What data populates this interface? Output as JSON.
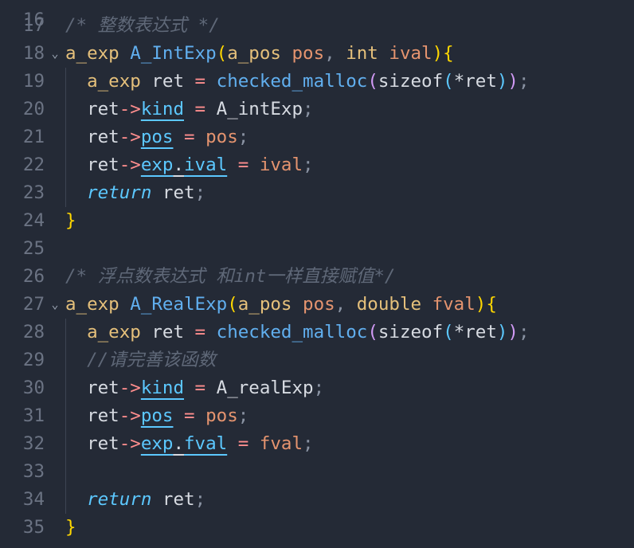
{
  "editor": {
    "top_partial_line_number": "16",
    "lines": [
      {
        "n": "17",
        "fold": false,
        "tokens": [
          {
            "t": "/* 整数表达式 */",
            "c": "t-comment"
          }
        ]
      },
      {
        "n": "18",
        "fold": true,
        "tokens": [
          {
            "t": "a_exp",
            "c": "t-type"
          },
          {
            "t": " ",
            "c": ""
          },
          {
            "t": "A_IntExp",
            "c": "t-fn"
          },
          {
            "t": "(",
            "c": "t-brace"
          },
          {
            "t": "a_pos",
            "c": "t-type"
          },
          {
            "t": " ",
            "c": ""
          },
          {
            "t": "pos",
            "c": "t-param"
          },
          {
            "t": ", ",
            "c": "t-punc"
          },
          {
            "t": "int",
            "c": "t-type"
          },
          {
            "t": " ",
            "c": ""
          },
          {
            "t": "ival",
            "c": "t-param"
          },
          {
            "t": "){",
            "c": "t-brace"
          }
        ]
      },
      {
        "n": "19",
        "fold": false,
        "tokens": [
          {
            "t": "  ",
            "c": ""
          },
          {
            "t": "a_exp",
            "c": "t-type"
          },
          {
            "t": " ",
            "c": ""
          },
          {
            "t": "ret",
            "c": "t-var"
          },
          {
            "t": " = ",
            "c": "t-op"
          },
          {
            "t": "checked_malloc",
            "c": "t-fn"
          },
          {
            "t": "(",
            "c": "t-paren1"
          },
          {
            "t": "sizeof",
            "c": "t-def"
          },
          {
            "t": "(",
            "c": "t-paren2"
          },
          {
            "t": "*",
            "c": "t-var"
          },
          {
            "t": "ret",
            "c": "t-var"
          },
          {
            "t": ")",
            "c": "t-paren2"
          },
          {
            "t": ")",
            "c": "t-paren1"
          },
          {
            "t": ";",
            "c": "t-punc"
          }
        ]
      },
      {
        "n": "20",
        "fold": false,
        "tokens": [
          {
            "t": "  ",
            "c": ""
          },
          {
            "t": "ret",
            "c": "t-var"
          },
          {
            "t": "->",
            "c": "t-op"
          },
          {
            "t": "kind",
            "c": "t-mem u"
          },
          {
            "t": " = ",
            "c": "t-op"
          },
          {
            "t": "A_intExp",
            "c": "t-var"
          },
          {
            "t": ";",
            "c": "t-punc"
          }
        ]
      },
      {
        "n": "21",
        "fold": false,
        "tokens": [
          {
            "t": "  ",
            "c": ""
          },
          {
            "t": "ret",
            "c": "t-var"
          },
          {
            "t": "->",
            "c": "t-op"
          },
          {
            "t": "pos",
            "c": "t-mem u"
          },
          {
            "t": " = ",
            "c": "t-op"
          },
          {
            "t": "pos",
            "c": "t-param"
          },
          {
            "t": ";",
            "c": "t-punc"
          }
        ]
      },
      {
        "n": "22",
        "fold": false,
        "tokens": [
          {
            "t": "  ",
            "c": ""
          },
          {
            "t": "ret",
            "c": "t-var"
          },
          {
            "t": "->",
            "c": "t-op"
          },
          {
            "t": "exp",
            "c": "t-mem u"
          },
          {
            "t": ".",
            "c": "t-var u"
          },
          {
            "t": "ival",
            "c": "t-mem u"
          },
          {
            "t": " = ",
            "c": "t-op"
          },
          {
            "t": "ival",
            "c": "t-param"
          },
          {
            "t": ";",
            "c": "t-punc"
          }
        ]
      },
      {
        "n": "23",
        "fold": false,
        "tokens": [
          {
            "t": "  ",
            "c": ""
          },
          {
            "t": "return",
            "c": "t-ret"
          },
          {
            "t": " ",
            "c": ""
          },
          {
            "t": "ret",
            "c": "t-var"
          },
          {
            "t": ";",
            "c": "t-punc"
          }
        ]
      },
      {
        "n": "24",
        "fold": false,
        "tokens": [
          {
            "t": "}",
            "c": "t-brace"
          }
        ]
      },
      {
        "n": "25",
        "fold": false,
        "tokens": []
      },
      {
        "n": "26",
        "fold": false,
        "tokens": [
          {
            "t": "/* 浮点数表达式 和int一样直接赋值*/",
            "c": "t-comment"
          }
        ]
      },
      {
        "n": "27",
        "fold": true,
        "tokens": [
          {
            "t": "a_exp",
            "c": "t-type"
          },
          {
            "t": " ",
            "c": ""
          },
          {
            "t": "A_RealExp",
            "c": "t-fn"
          },
          {
            "t": "(",
            "c": "t-brace"
          },
          {
            "t": "a_pos",
            "c": "t-type"
          },
          {
            "t": " ",
            "c": ""
          },
          {
            "t": "pos",
            "c": "t-param"
          },
          {
            "t": ", ",
            "c": "t-punc"
          },
          {
            "t": "double",
            "c": "t-type"
          },
          {
            "t": " ",
            "c": ""
          },
          {
            "t": "fval",
            "c": "t-param"
          },
          {
            "t": "){",
            "c": "t-brace"
          }
        ]
      },
      {
        "n": "28",
        "fold": false,
        "tokens": [
          {
            "t": "  ",
            "c": ""
          },
          {
            "t": "a_exp",
            "c": "t-type"
          },
          {
            "t": " ",
            "c": ""
          },
          {
            "t": "ret",
            "c": "t-var"
          },
          {
            "t": " = ",
            "c": "t-op"
          },
          {
            "t": "checked_malloc",
            "c": "t-fn"
          },
          {
            "t": "(",
            "c": "t-paren1"
          },
          {
            "t": "sizeof",
            "c": "t-def"
          },
          {
            "t": "(",
            "c": "t-paren2"
          },
          {
            "t": "*",
            "c": "t-var"
          },
          {
            "t": "ret",
            "c": "t-var"
          },
          {
            "t": ")",
            "c": "t-paren2"
          },
          {
            "t": ")",
            "c": "t-paren1"
          },
          {
            "t": ";",
            "c": "t-punc"
          }
        ]
      },
      {
        "n": "29",
        "fold": false,
        "tokens": [
          {
            "t": "  ",
            "c": ""
          },
          {
            "t": "//请完善该函数",
            "c": "t-comment"
          }
        ]
      },
      {
        "n": "30",
        "fold": false,
        "tokens": [
          {
            "t": "  ",
            "c": ""
          },
          {
            "t": "ret",
            "c": "t-var"
          },
          {
            "t": "->",
            "c": "t-op"
          },
          {
            "t": "kind",
            "c": "t-mem u"
          },
          {
            "t": " = ",
            "c": "t-op"
          },
          {
            "t": "A_realExp",
            "c": "t-var"
          },
          {
            "t": ";",
            "c": "t-punc"
          }
        ]
      },
      {
        "n": "31",
        "fold": false,
        "tokens": [
          {
            "t": "  ",
            "c": ""
          },
          {
            "t": "ret",
            "c": "t-var"
          },
          {
            "t": "->",
            "c": "t-op"
          },
          {
            "t": "pos",
            "c": "t-mem u"
          },
          {
            "t": " = ",
            "c": "t-op"
          },
          {
            "t": "pos",
            "c": "t-param"
          },
          {
            "t": ";",
            "c": "t-punc"
          }
        ]
      },
      {
        "n": "32",
        "fold": false,
        "tokens": [
          {
            "t": "  ",
            "c": ""
          },
          {
            "t": "ret",
            "c": "t-var"
          },
          {
            "t": "->",
            "c": "t-op"
          },
          {
            "t": "exp",
            "c": "t-mem u"
          },
          {
            "t": ".",
            "c": "t-var u"
          },
          {
            "t": "fval",
            "c": "t-mem u"
          },
          {
            "t": " = ",
            "c": "t-op"
          },
          {
            "t": "fval",
            "c": "t-param"
          },
          {
            "t": ";",
            "c": "t-punc"
          }
        ]
      },
      {
        "n": "33",
        "fold": false,
        "tokens": []
      },
      {
        "n": "34",
        "fold": false,
        "tokens": [
          {
            "t": "  ",
            "c": ""
          },
          {
            "t": "return",
            "c": "t-ret"
          },
          {
            "t": " ",
            "c": ""
          },
          {
            "t": "ret",
            "c": "t-var"
          },
          {
            "t": ";",
            "c": "t-punc"
          }
        ]
      },
      {
        "n": "35",
        "fold": false,
        "tokens": [
          {
            "t": "}",
            "c": "t-brace"
          }
        ]
      }
    ]
  }
}
